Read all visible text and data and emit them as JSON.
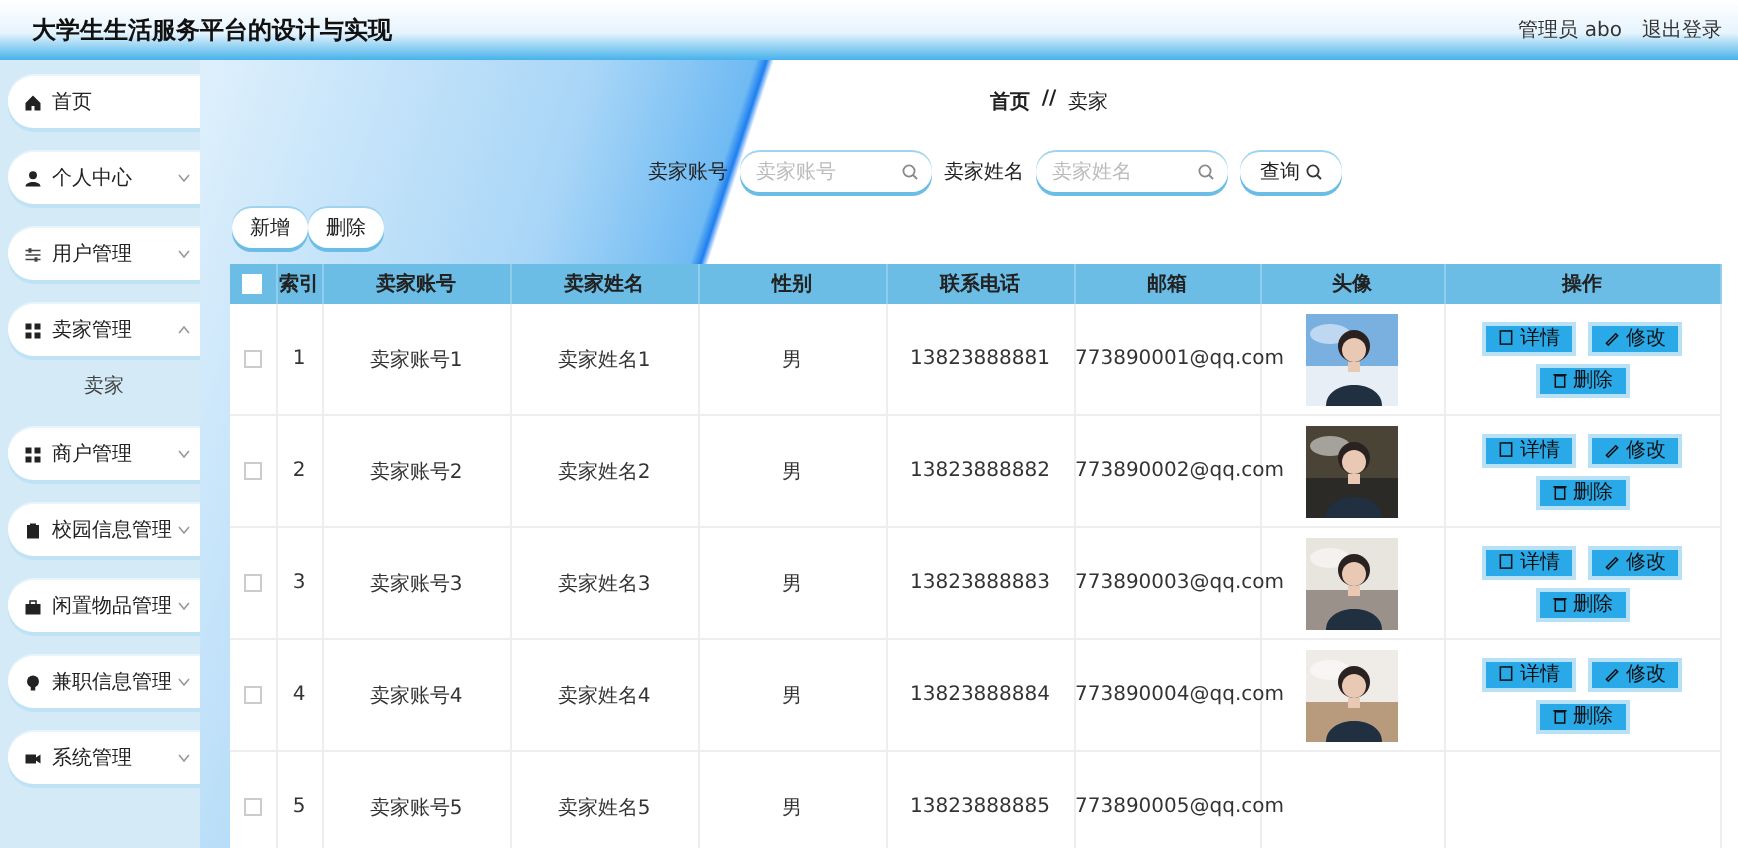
{
  "header": {
    "title": "大学生生活服务平台的设计与实现",
    "user": "管理员 abo",
    "logout": "退出登录"
  },
  "sidebar": {
    "items": [
      {
        "label": "首页",
        "kind": "link"
      },
      {
        "label": "个人中心",
        "kind": "menu",
        "expanded": false
      },
      {
        "label": "用户管理",
        "kind": "menu",
        "expanded": false
      },
      {
        "label": "卖家管理",
        "kind": "menu",
        "expanded": true,
        "children": [
          {
            "label": "卖家"
          }
        ]
      },
      {
        "label": "商户管理",
        "kind": "menu",
        "expanded": false
      },
      {
        "label": "校园信息管理",
        "kind": "menu",
        "expanded": false
      },
      {
        "label": "闲置物品管理",
        "kind": "menu",
        "expanded": false
      },
      {
        "label": "兼职信息管理",
        "kind": "menu",
        "expanded": false
      },
      {
        "label": "系统管理",
        "kind": "menu",
        "expanded": false
      }
    ]
  },
  "breadcrumb": {
    "home": "首页",
    "separator": "//",
    "current": "卖家"
  },
  "search": {
    "fields": [
      {
        "label": "卖家账号",
        "placeholder": "卖家账号"
      },
      {
        "label": "卖家姓名",
        "placeholder": "卖家姓名"
      }
    ],
    "button": "查询"
  },
  "toolbar": {
    "buttons": [
      "新增",
      "删除"
    ]
  },
  "table": {
    "select_all": {
      "checked": false
    },
    "columns": [
      "索引",
      "卖家账号",
      "卖家姓名",
      "性别",
      "联系电话",
      "邮箱",
      "头像",
      "操作"
    ],
    "rows": [
      {
        "checked": false,
        "cells": [
          "1",
          "卖家账号1",
          "卖家姓名1",
          "男",
          "13823888881",
          "773890001@qq.com"
        ],
        "actions": [
          "详情",
          "修改",
          "删除"
        ]
      },
      {
        "checked": false,
        "cells": [
          "2",
          "卖家账号2",
          "卖家姓名2",
          "男",
          "13823888882",
          "773890002@qq.com"
        ],
        "actions": [
          "详情",
          "修改",
          "删除"
        ]
      },
      {
        "checked": false,
        "cells": [
          "3",
          "卖家账号3",
          "卖家姓名3",
          "男",
          "13823888883",
          "773890003@qq.com"
        ],
        "actions": [
          "详情",
          "修改",
          "删除"
        ]
      },
      {
        "checked": false,
        "cells": [
          "4",
          "卖家账号4",
          "卖家姓名4",
          "男",
          "13823888884",
          "773890004@qq.com"
        ],
        "actions": [
          "详情",
          "修改",
          "删除"
        ]
      },
      {
        "checked": false,
        "cells": [
          "5",
          "卖家账号5",
          "卖家姓名5",
          "男",
          "13823888885",
          "773890005@qq.com"
        ]
      }
    ]
  }
}
